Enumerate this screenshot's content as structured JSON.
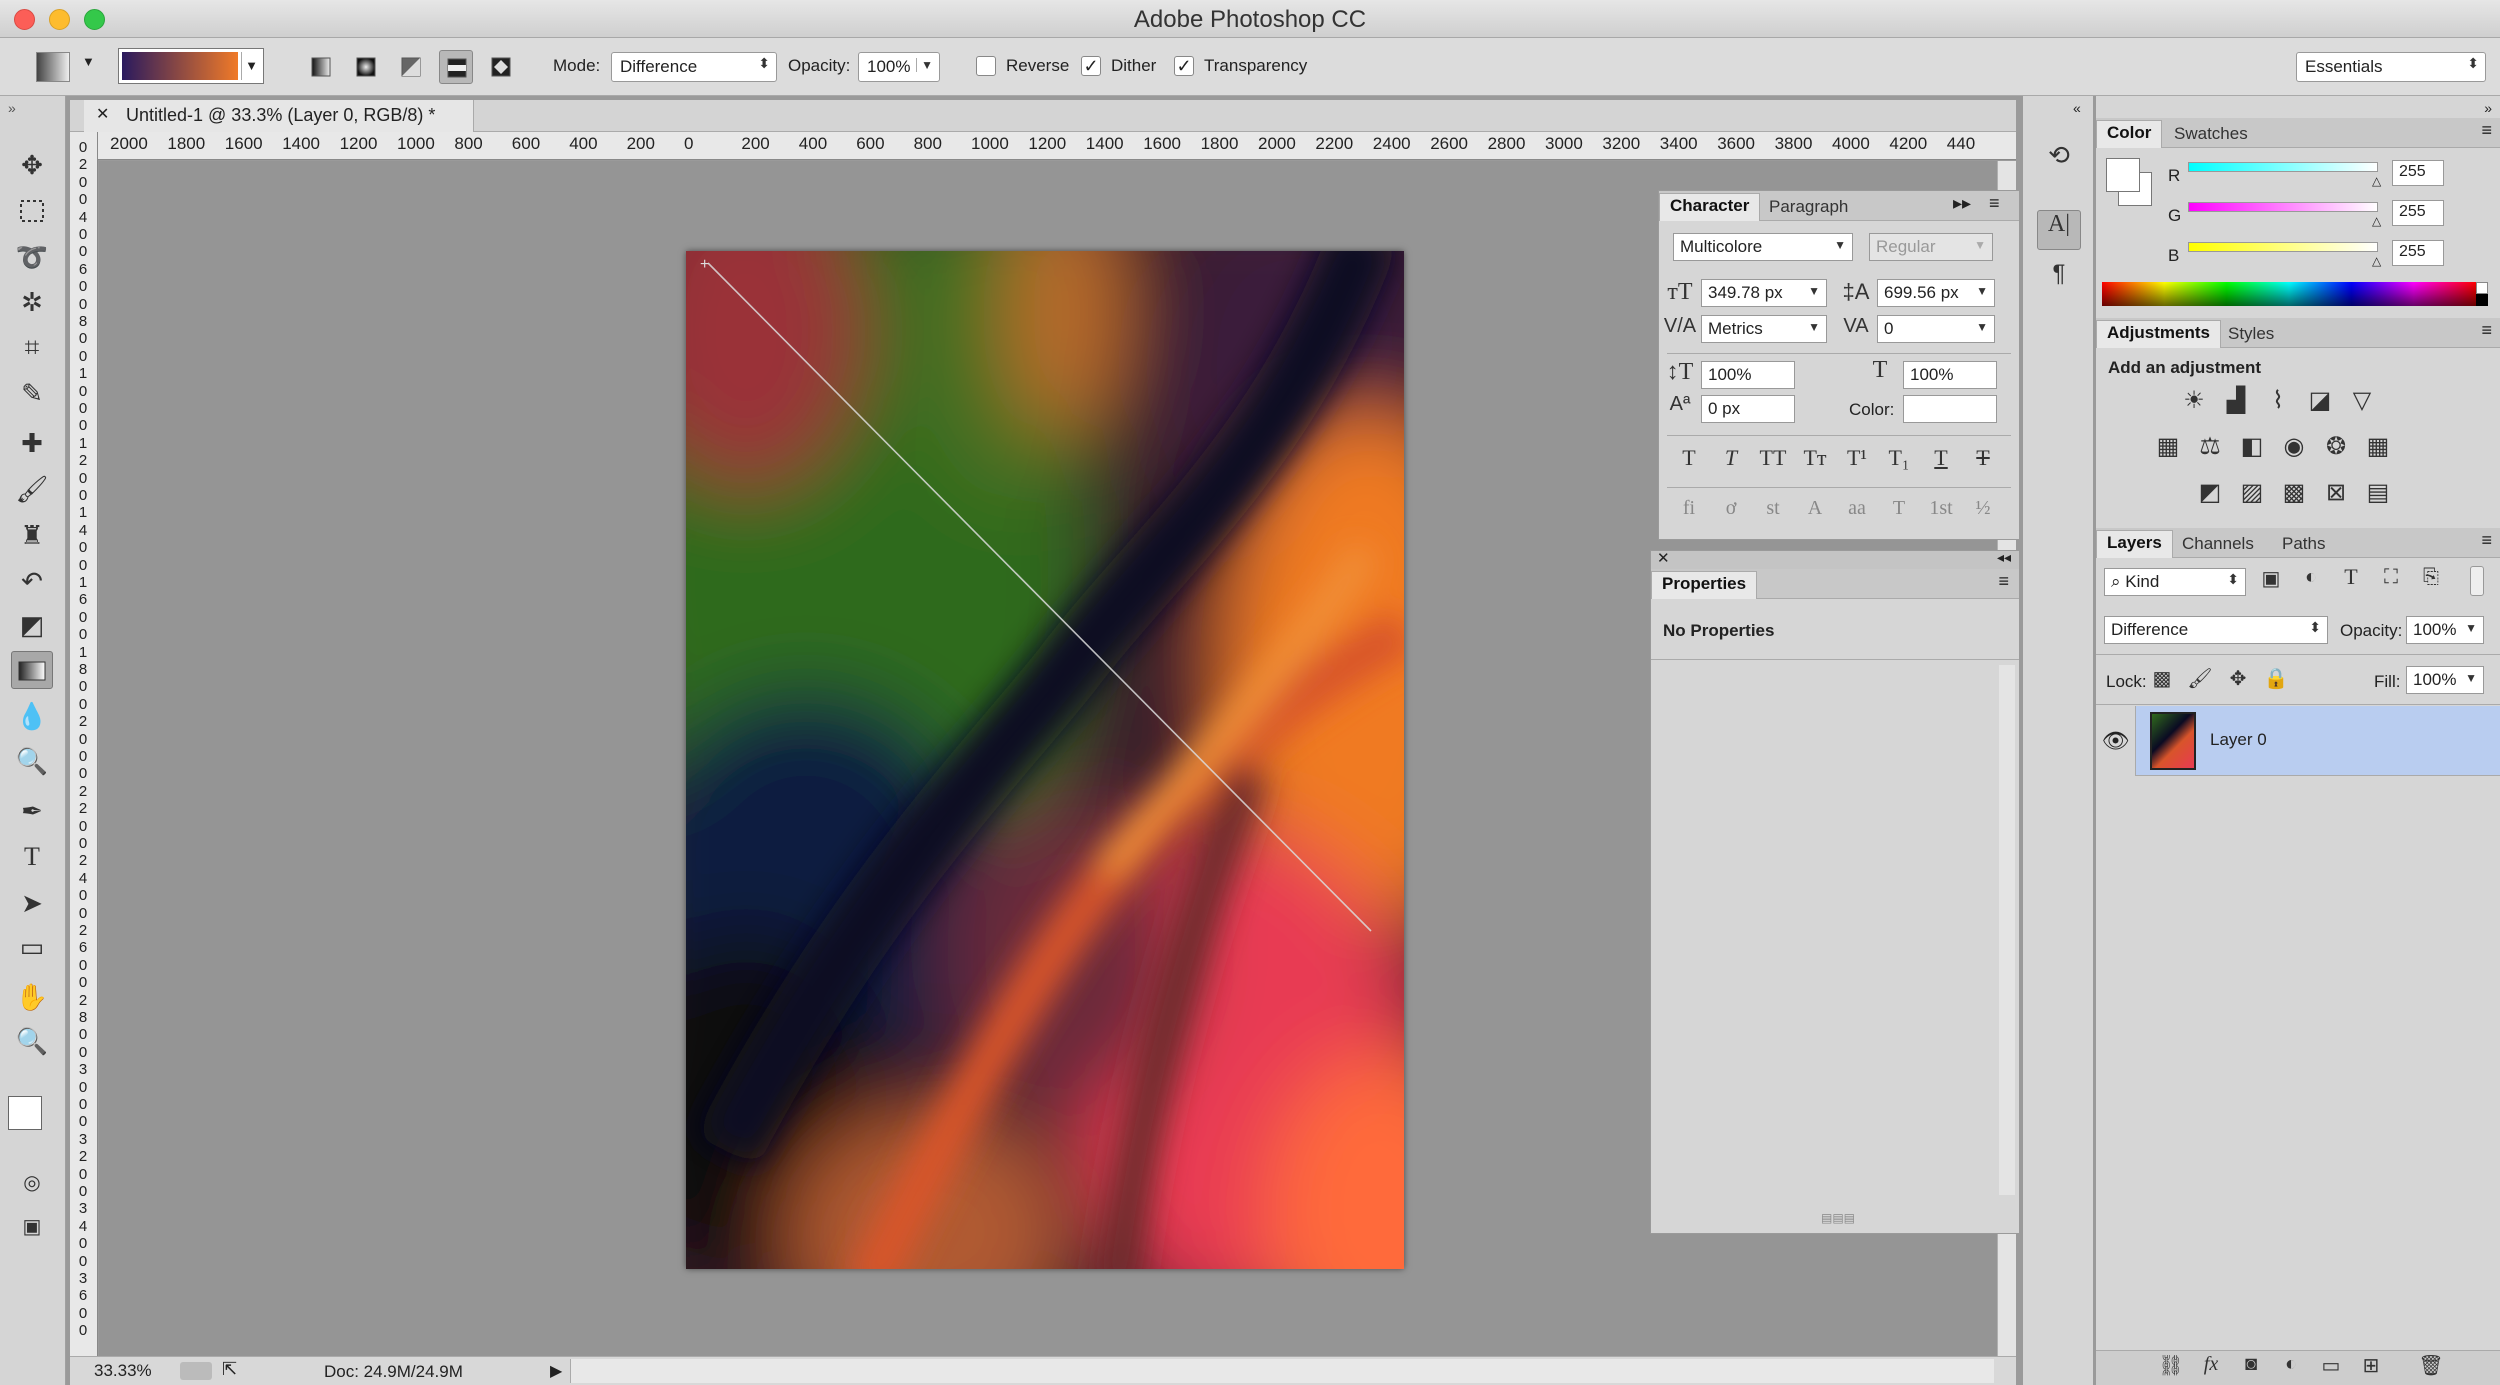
{
  "app": {
    "title": "Adobe Photoshop CC",
    "workspace": "Essentials"
  },
  "options": {
    "mode_label": "Mode:",
    "mode_value": "Difference",
    "opacity_label": "Opacity:",
    "opacity_value": "100%",
    "reverse_label": "Reverse",
    "dither_label": "Dither",
    "transparency_label": "Transparency",
    "reverse_checked": false,
    "dither_checked": true,
    "transparency_checked": true,
    "gradient_from": "#2a1a5e",
    "gradient_to": "#f07a28"
  },
  "document": {
    "tab_title": "Untitled-1 @ 33.3% (Layer 0, RGB/8) *",
    "zoom": "33.33%",
    "doc_size": "Doc: 24.9M/24.9M",
    "ruler_h": [
      "2000",
      "1800",
      "1600",
      "1400",
      "1200",
      "1000",
      "800",
      "600",
      "400",
      "200",
      "0",
      "200",
      "400",
      "600",
      "800",
      "1000",
      "1200",
      "1400",
      "1600",
      "1800",
      "2000",
      "2200",
      "2400",
      "2600",
      "2800",
      "3000",
      "3200",
      "3400",
      "3600",
      "3800",
      "4000",
      "4200",
      "440"
    ],
    "ruler_v": [
      "0",
      "2",
      "0",
      "0",
      "4",
      "0",
      "0",
      "6",
      "0",
      "0",
      "8",
      "0",
      "0",
      "1",
      "0",
      "0",
      "0",
      "1",
      "2",
      "0",
      "0",
      "1",
      "4",
      "0",
      "0",
      "1",
      "6",
      "0",
      "0",
      "1",
      "8",
      "0",
      "0",
      "2",
      "0",
      "0",
      "0",
      "2",
      "2",
      "0",
      "0",
      "2",
      "4",
      "0",
      "0",
      "2",
      "6",
      "0",
      "0",
      "2",
      "8",
      "0",
      "0",
      "3",
      "0",
      "0",
      "0",
      "3",
      "2",
      "0",
      "0",
      "3",
      "4",
      "0",
      "0",
      "3",
      "6",
      "0",
      "0"
    ]
  },
  "character": {
    "tab_character": "Character",
    "tab_paragraph": "Paragraph",
    "font_family": "Multicolore",
    "font_style": "Regular",
    "font_size": "349.78 px",
    "leading": "699.56 px",
    "kerning": "Metrics",
    "tracking": "0",
    "vscale": "100%",
    "hscale": "100%",
    "baseline": "0 px",
    "color_label": "Color:",
    "style_buttons": [
      "T",
      "T",
      "TT",
      "Tт",
      "T¹",
      "T₁",
      "T",
      "T"
    ],
    "opentype_buttons": [
      "fi",
      "ơ",
      "st",
      "A",
      "aa",
      "T",
      "1st",
      "½"
    ]
  },
  "properties": {
    "tab": "Properties",
    "message": "No Properties"
  },
  "color": {
    "tab_color": "Color",
    "tab_swatches": "Swatches",
    "r_label": "R",
    "g_label": "G",
    "b_label": "B",
    "r": "255",
    "g": "255",
    "b": "255"
  },
  "adjustments": {
    "tab_adjustments": "Adjustments",
    "tab_styles": "Styles",
    "heading": "Add an adjustment"
  },
  "layers": {
    "tab_layers": "Layers",
    "tab_channels": "Channels",
    "tab_paths": "Paths",
    "filter_kind": "Kind",
    "blend_mode": "Difference",
    "opacity_label": "Opacity:",
    "opacity": "100%",
    "lock_label": "Lock:",
    "fill_label": "Fill:",
    "fill": "100%",
    "items": [
      {
        "name": "Layer 0",
        "visible": true,
        "selected": true
      }
    ],
    "footer_icons": [
      "link-icon",
      "fx-icon",
      "mask-icon",
      "adjustment-layer-icon",
      "group-icon",
      "new-layer-icon",
      "trash-icon"
    ]
  },
  "colors": {
    "selection": "#b9cdf0",
    "panel_bg": "#d6d6d6"
  }
}
